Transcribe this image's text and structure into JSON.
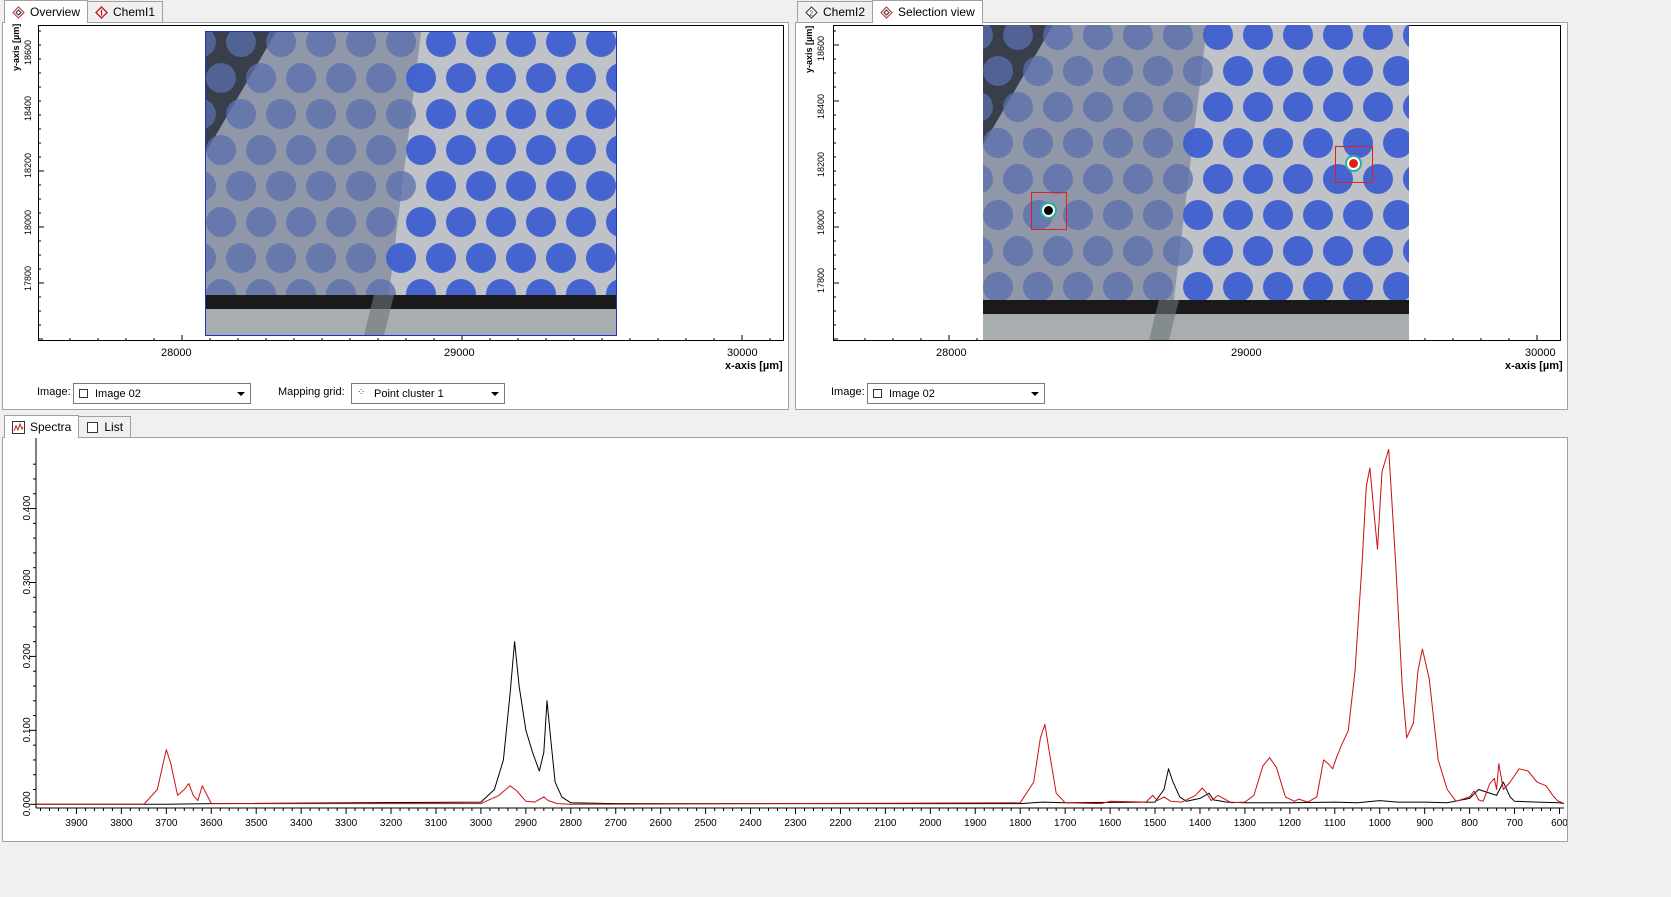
{
  "left_panel": {
    "tabs": [
      {
        "label": "Overview",
        "active": true,
        "icon": "overview-diamond-icon"
      },
      {
        "label": "ChemI1",
        "active": false,
        "icon": "chemi-red-diamond-icon"
      }
    ],
    "y_axis_label": "y-axis [µm]",
    "x_axis_label": "x-axis [µm]",
    "y_ticks": [
      "18600",
      "18400",
      "18200",
      "18000",
      "17800"
    ],
    "x_ticks": [
      "28000",
      "29000",
      "30000"
    ],
    "image_label": "Image:",
    "image_value": "Image 02",
    "mapping_label": "Mapping grid:",
    "mapping_value": "Point cluster 1"
  },
  "right_panel": {
    "tabs": [
      {
        "label": "ChemI2",
        "active": false,
        "icon": "chemi2-icon"
      },
      {
        "label": "Selection view",
        "active": true,
        "icon": "selection-diamond-icon"
      }
    ],
    "y_axis_label": "y-axis [µm]",
    "x_axis_label": "x-axis [µm]",
    "y_ticks": [
      "18600",
      "18400",
      "18200",
      "18000",
      "17800"
    ],
    "x_ticks": [
      "28000",
      "29000",
      "30000"
    ],
    "image_label": "Image:",
    "image_value": "Image 02"
  },
  "bottom_panel": {
    "tabs": [
      {
        "label": "Spectra",
        "active": true,
        "icon": "spectra-chart-icon"
      },
      {
        "label": "List",
        "active": false,
        "icon": "list-box-icon"
      }
    ]
  },
  "colors": {
    "black_series": "#000000",
    "red_series": "#cc1010",
    "dot_blue": "#3a5ad8",
    "marker_red": "#e02020"
  },
  "chart_data": {
    "type": "line",
    "title": "",
    "xlabel": "",
    "ylabel": "",
    "xlim": [
      3990,
      590
    ],
    "ylim": [
      -0.005,
      0.49
    ],
    "x_reversed": true,
    "x_ticks": [
      3900,
      3800,
      3700,
      3600,
      3500,
      3400,
      3300,
      3200,
      3100,
      3000,
      2900,
      2800,
      2700,
      2600,
      2500,
      2400,
      2300,
      2200,
      2100,
      2000,
      1900,
      1800,
      1700,
      1600,
      1500,
      1400,
      1300,
      1200,
      1100,
      1000,
      900,
      800,
      700,
      600
    ],
    "y_ticks": [
      "0.000",
      "0.100",
      "0.200",
      "0.300",
      "0.400"
    ],
    "y_tick_values": [
      0,
      0.1,
      0.2,
      0.3,
      0.4
    ],
    "grid": false,
    "legend": "none",
    "series": [
      {
        "color": "black",
        "x": [
          3990,
          3700,
          3600,
          3000,
          2970,
          2950,
          2935,
          2925,
          2915,
          2900,
          2885,
          2870,
          2860,
          2853,
          2845,
          2835,
          2820,
          2800,
          2700,
          1800,
          1750,
          1700,
          1500,
          1480,
          1470,
          1460,
          1445,
          1430,
          1400,
          1380,
          1370,
          1340,
          1300,
          1200,
          1100,
          1050,
          1000,
          960,
          900,
          850,
          800,
          780,
          740,
          725,
          710,
          700,
          650,
          600,
          590
        ],
        "y": [
          0.0,
          0.0,
          0.001,
          0.003,
          0.02,
          0.06,
          0.15,
          0.22,
          0.16,
          0.1,
          0.07,
          0.045,
          0.07,
          0.14,
          0.09,
          0.03,
          0.01,
          0.002,
          0.001,
          0.001,
          0.003,
          0.002,
          0.003,
          0.02,
          0.048,
          0.03,
          0.01,
          0.004,
          0.008,
          0.015,
          0.006,
          0.003,
          0.002,
          0.002,
          0.003,
          0.002,
          0.005,
          0.003,
          0.003,
          0.002,
          0.008,
          0.02,
          0.012,
          0.03,
          0.01,
          0.004,
          0.003,
          0.002,
          0.001
        ]
      },
      {
        "color": "red",
        "x": [
          3990,
          3750,
          3720,
          3700,
          3690,
          3675,
          3660,
          3650,
          3640,
          3630,
          3620,
          3600,
          3000,
          2960,
          2935,
          2920,
          2900,
          2880,
          2860,
          2850,
          2830,
          2800,
          1800,
          1770,
          1755,
          1745,
          1735,
          1720,
          1700,
          1620,
          1600,
          1520,
          1505,
          1495,
          1480,
          1465,
          1440,
          1410,
          1395,
          1385,
          1375,
          1360,
          1345,
          1330,
          1300,
          1280,
          1260,
          1245,
          1230,
          1210,
          1190,
          1180,
          1160,
          1140,
          1125,
          1115,
          1105,
          1095,
          1085,
          1070,
          1055,
          1040,
          1030,
          1022,
          1012,
          1005,
          995,
          980,
          965,
          950,
          940,
          925,
          915,
          905,
          890,
          870,
          850,
          830,
          800,
          790,
          780,
          770,
          755,
          745,
          740,
          735,
          725,
          710,
          690,
          670,
          650,
          630,
          615,
          605,
          590
        ],
        "y": [
          0.0,
          0.0,
          0.02,
          0.074,
          0.055,
          0.012,
          0.02,
          0.028,
          0.012,
          0.005,
          0.025,
          0.001,
          0.001,
          0.012,
          0.025,
          0.018,
          0.004,
          0.003,
          0.01,
          0.005,
          0.001,
          0.0,
          0.002,
          0.03,
          0.09,
          0.108,
          0.07,
          0.015,
          0.002,
          0.001,
          0.004,
          0.003,
          0.012,
          0.005,
          0.01,
          0.004,
          0.003,
          0.012,
          0.022,
          0.015,
          0.005,
          0.012,
          0.007,
          0.002,
          0.003,
          0.012,
          0.052,
          0.063,
          0.05,
          0.01,
          0.004,
          0.007,
          0.003,
          0.01,
          0.06,
          0.055,
          0.048,
          0.065,
          0.08,
          0.1,
          0.18,
          0.32,
          0.43,
          0.455,
          0.39,
          0.345,
          0.45,
          0.48,
          0.33,
          0.16,
          0.09,
          0.11,
          0.18,
          0.21,
          0.17,
          0.06,
          0.02,
          0.004,
          0.01,
          0.018,
          0.006,
          0.004,
          0.028,
          0.035,
          0.02,
          0.055,
          0.02,
          0.03,
          0.048,
          0.045,
          0.03,
          0.025,
          0.012,
          0.005,
          0.001
        ]
      }
    ]
  }
}
